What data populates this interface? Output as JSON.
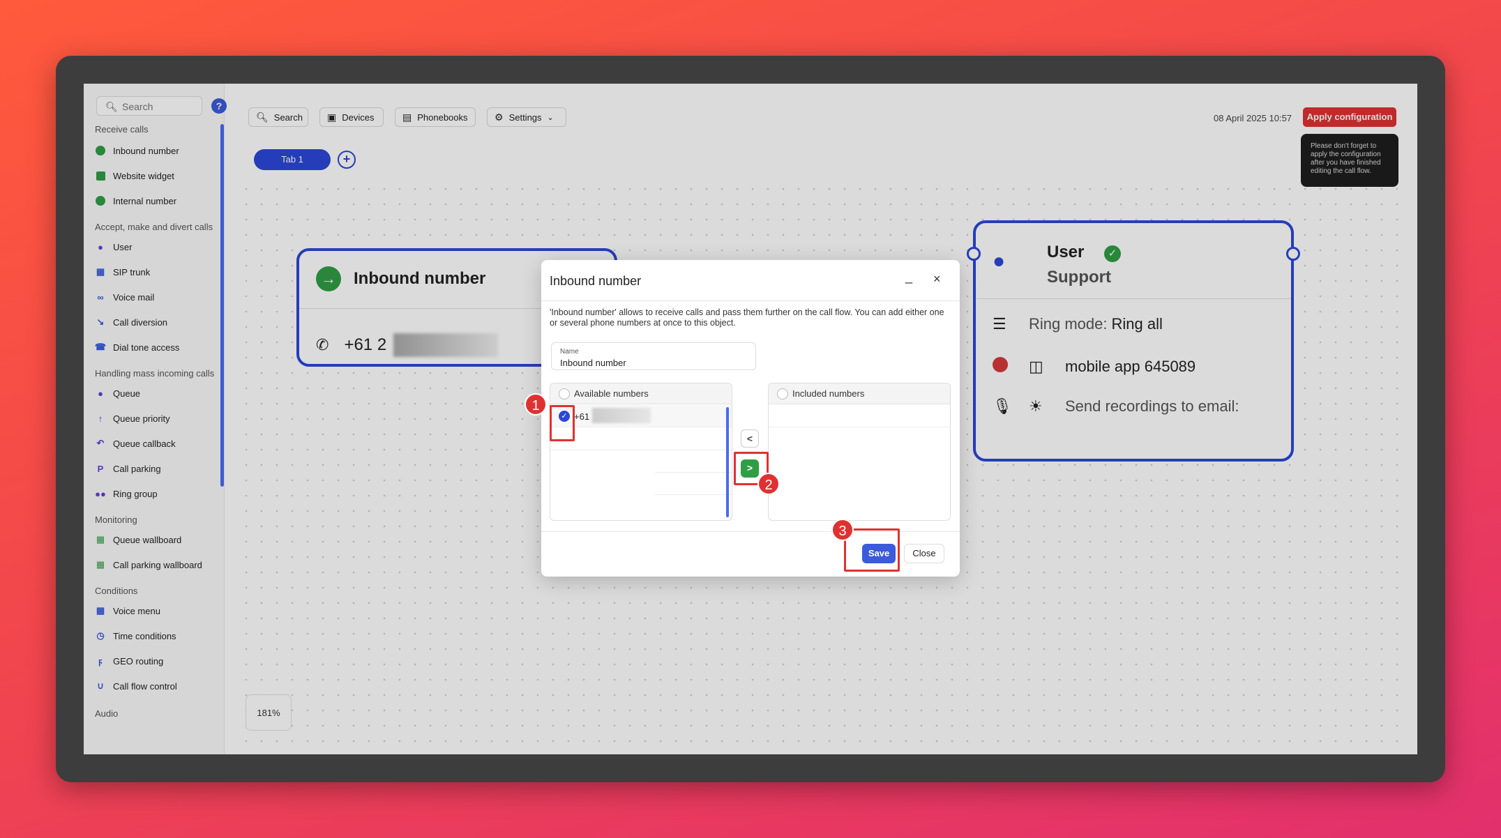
{
  "sidebar": {
    "search_placeholder": "Search",
    "groups": {
      "receive": "Receive calls",
      "accept": "Accept, make and divert calls",
      "mass": "Handling mass incoming calls",
      "monitoring": "Monitoring",
      "conditions": "Conditions",
      "audio": "Audio"
    },
    "items": {
      "inbound_number": "Inbound number",
      "website_widget": "Website widget",
      "internal_number": "Internal number",
      "user": "User",
      "sip_trunk": "SIP trunk",
      "voice_mail": "Voice mail",
      "call_diversion": "Call diversion",
      "dial_tone_access": "Dial tone access",
      "queue": "Queue",
      "queue_priority": "Queue priority",
      "queue_callback": "Queue callback",
      "call_parking": "Call parking",
      "ring_group": "Ring group",
      "queue_wallboard": "Queue wallboard",
      "call_parking_wallboard": "Call parking wallboard",
      "voice_menu": "Voice menu",
      "time_conditions": "Time conditions",
      "geo_routing": "GEO routing",
      "call_flow_control": "Call flow control"
    }
  },
  "toolbar": {
    "search": "Search",
    "devices": "Devices",
    "phonebooks": "Phonebooks",
    "settings": "Settings",
    "datetime": "08 April 2025 10:57",
    "apply": "Apply configuration",
    "tooltip": "Please don't forget to apply the configuration after you have finished editing the call flow."
  },
  "tabs": {
    "tab1": "Tab 1",
    "add": "+"
  },
  "canvas": {
    "zoom": "181%",
    "inbound_node": {
      "title": "Inbound number",
      "number": "+61 2"
    },
    "user_node": {
      "title": "User",
      "subtitle": "Support",
      "ring_mode_label": "Ring mode:",
      "ring_mode_value": "Ring all",
      "device": "mobile app 645089",
      "recordings": "Send recordings to email:"
    }
  },
  "modal": {
    "title": "Inbound number",
    "minimize": "_",
    "close_icon": "×",
    "description": "'Inbound number' allows to receive calls and pass them further on the call flow. You can add either one or several phone numbers at once to this object.",
    "name_label": "Name",
    "name_value": "Inbound number",
    "available_header": "Available numbers",
    "included_header": "Included numbers",
    "available_row1": "+61",
    "move_left": "<",
    "move_right": ">",
    "save": "Save",
    "close": "Close"
  },
  "annotations": {
    "step1": "1",
    "step2": "2",
    "step3": "3"
  },
  "colors": {
    "accent": "#2c47d8",
    "apply": "#e03131",
    "green": "#2f9e44",
    "highlight": "#e03131"
  }
}
